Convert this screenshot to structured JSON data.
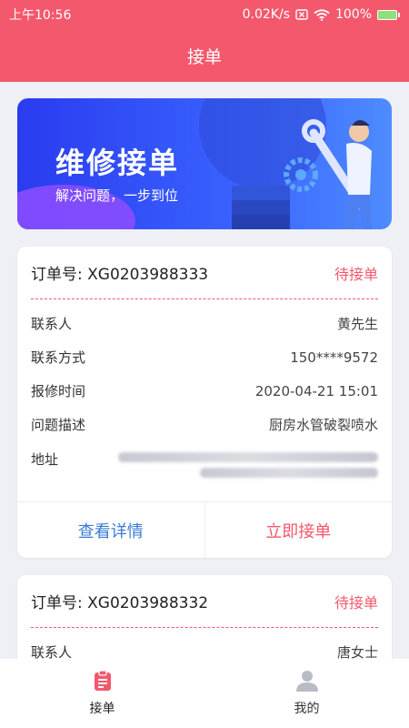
{
  "status_bar": {
    "time": "上午10:56",
    "speed": "0.02K/s",
    "battery": "100%"
  },
  "header": {
    "title": "接单"
  },
  "banner": {
    "title": "维修接单",
    "subtitle": "解决问题，一步到位"
  },
  "labels": {
    "contact": "联系人",
    "phone": "联系方式",
    "time": "报修时间",
    "problem": "问题描述",
    "address": "地址"
  },
  "orders": [
    {
      "order_no": "订单号: XG0203988333",
      "status": "待接单",
      "contact": "黄先生",
      "phone": "150****9572",
      "time": "2020-04-21 15:01",
      "problem": "厨房水管破裂喷水",
      "view_details": "查看详情",
      "accept": "立即接单"
    },
    {
      "order_no": "订单号: XG0203988332",
      "status": "待接单",
      "contact": "唐女士"
    }
  ],
  "tabbar": {
    "tab1": "接单",
    "tab2": "我的"
  },
  "colors": {
    "accent": "#f4586d",
    "link": "#3a7bd5",
    "banner": "#2a3cf0"
  }
}
